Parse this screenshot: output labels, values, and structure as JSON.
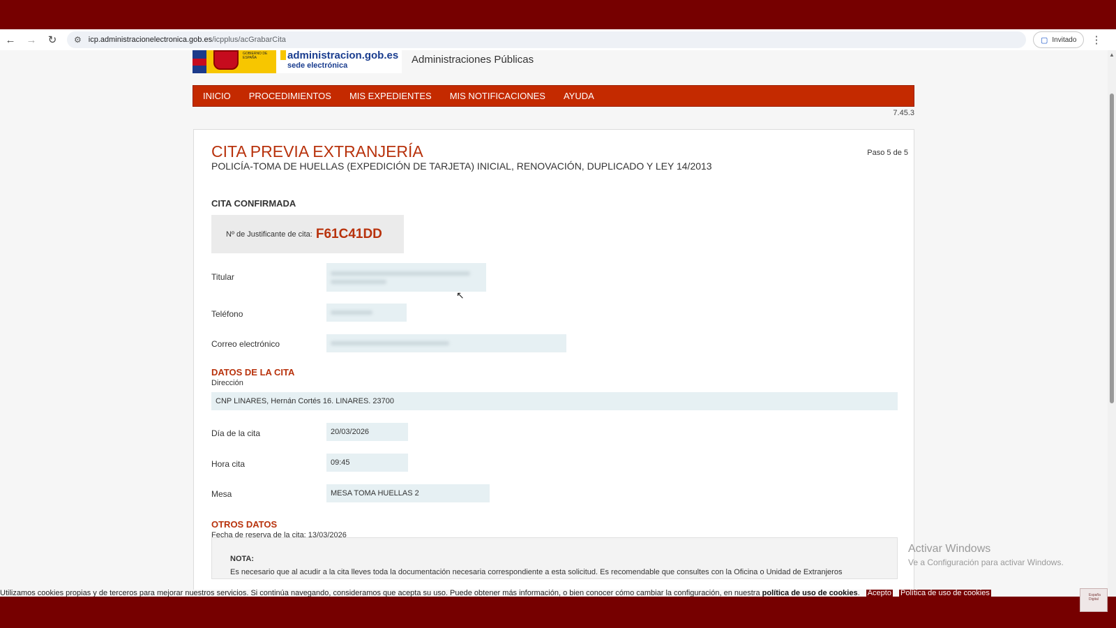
{
  "browser": {
    "url_host": "icp.administracionelectronica.gob.es",
    "url_path": "/icpplus/acGrabarCita",
    "profile_label": "Invitado"
  },
  "site": {
    "logo_gob_text": "GOBIERNO DE ESPAÑA",
    "logo_admin_line1": "administracion.gob.es",
    "logo_admin_line2": "sede electrónica",
    "header_title": "Administraciones Públicas",
    "nav": [
      "INICIO",
      "PROCEDIMIENTOS",
      "MIS EXPEDIENTES",
      "MIS NOTIFICACIONES",
      "AYUDA"
    ],
    "version": "7.45.3"
  },
  "card": {
    "title": "CITA PREVIA EXTRANJERÍA",
    "subtitle": "POLICÍA-TOMA DE HUELLAS (EXPEDICIÓN DE TARJETA) INICIAL, RENOVACIÓN, DUPLICADO Y LEY 14/2013",
    "step": "Paso 5 de 5",
    "confirm_heading": "CITA CONFIRMADA",
    "justificante_label": "Nº de Justificante de cita:",
    "justificante_code": "F61C41DD",
    "titular_label": "Titular",
    "telefono_label": "Teléfono",
    "correo_label": "Correo electrónico"
  },
  "datos_cita": {
    "heading": "DATOS DE LA CITA",
    "direccion_label": "Dirección",
    "direccion_value": "CNP LINARES, Hernán Cortés 16. LINARES. 23700",
    "dia_label": "Día de la cita",
    "dia_value": "20/03/2026",
    "hora_label": "Hora cita",
    "hora_value": "09:45",
    "mesa_label": "Mesa",
    "mesa_value": "MESA TOMA HUELLAS 2"
  },
  "otros_datos": {
    "heading": "OTROS DATOS",
    "fecha_reserva": "Fecha de reserva de la cita: 13/03/2026",
    "nota_title": "NOTA:",
    "nota_text": "Es necesario que al acudir a la cita lleves toda la documentación necesaria correspondiente a esta solicitud. Es recomendable que consultes con la Oficina o Unidad de Extranjeros"
  },
  "windows_watermark": {
    "line1": "Activar Windows",
    "line2": "Ve a Configuración para activar Windows."
  },
  "cookies": {
    "text": "Utilizamos cookies propias y de terceros para mejorar nuestros servicios. Si continúa navegando, consideramos que acepta su uso. Puede obtener más información, o bien conocer cómo cambiar la configuración, en nuestra",
    "policy_link": "política de uso de cookies",
    "accept_button": "Acepto",
    "policy_button": "Política de uso de cookies"
  },
  "colors": {
    "brand_red": "#c42a00",
    "title_red": "#b8320c",
    "band": "#760000",
    "field_bg": "#e6f0f3"
  }
}
